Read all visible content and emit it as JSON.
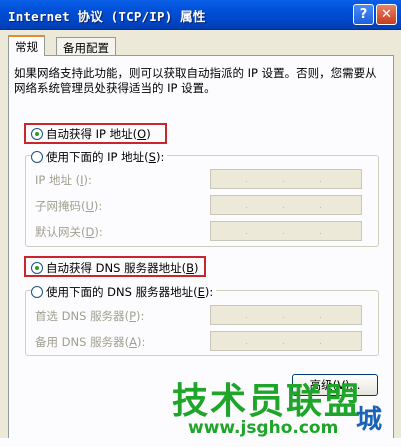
{
  "window": {
    "title": "Internet 协议 (TCP/IP) 属性",
    "help_glyph": "?",
    "close_glyph": "✕"
  },
  "tabs": [
    {
      "label": "常规",
      "active": true
    },
    {
      "label": "备用配置",
      "active": false
    }
  ],
  "intro_text": "如果网络支持此功能，则可以获取自动指派的 IP 设置。否则，您需要从网络系统管理员处获得适当的 IP 设置。",
  "ip_section": {
    "auto_option": {
      "label": "自动获得 IP 地址",
      "key": "O",
      "selected": true
    },
    "manual_option": {
      "label": "使用下面的 IP 地址",
      "key": "S",
      "selected": false
    },
    "fields": [
      {
        "label": "IP 地址",
        "key": "I"
      },
      {
        "label": "子网掩码",
        "key": "U"
      },
      {
        "label": "默认网关",
        "key": "D"
      }
    ]
  },
  "dns_section": {
    "auto_option": {
      "label": "自动获得 DNS 服务器地址",
      "key": "B",
      "selected": true
    },
    "manual_option": {
      "label": "使用下面的 DNS 服务器地址",
      "key": "E",
      "selected": false
    },
    "fields": [
      {
        "label": "首选 DNS 服务器",
        "key": "P"
      },
      {
        "label": "备用 DNS 服务器",
        "key": "A"
      }
    ]
  },
  "advanced_button": "高级(V)...",
  "watermark": {
    "title": "技术员联盟",
    "url": "www.jsgho.com",
    "extra": "城"
  },
  "colors": {
    "highlight_border": "#c8262c",
    "titlebar": "#0050d8",
    "watermark_green": "#1ea52a"
  }
}
